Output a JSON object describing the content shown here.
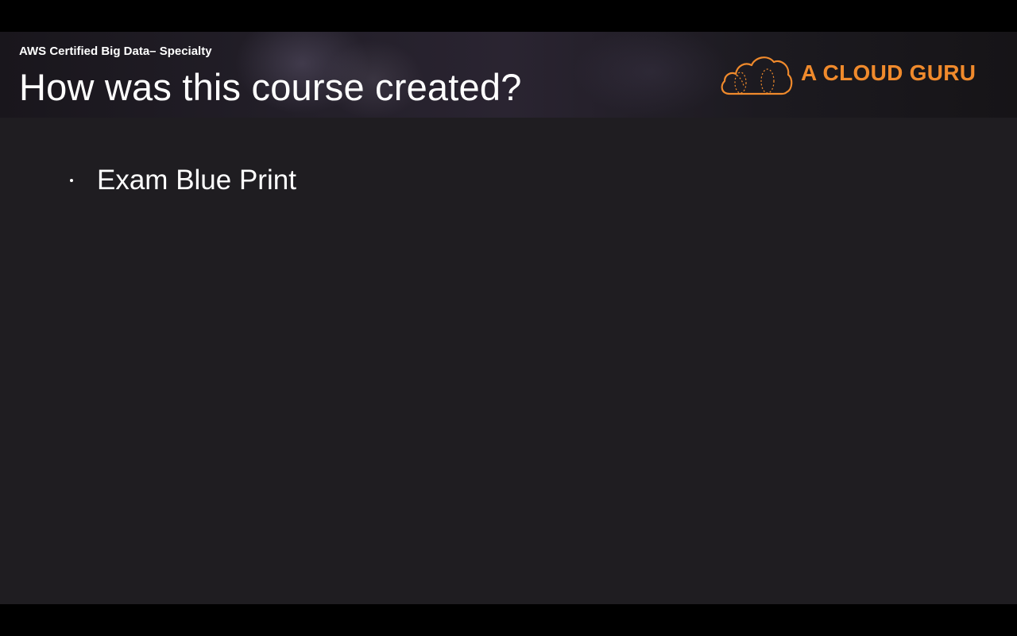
{
  "slide": {
    "course_subtitle": "AWS Certified Big Data– Specialty",
    "title": "How was this course created?",
    "bullets": [
      {
        "text": "Exam Blue Print"
      }
    ]
  },
  "logo": {
    "text": "A CLOUD GURU",
    "icon": "cloud-icon",
    "color": "#f08a2c"
  },
  "colors": {
    "slide_background": "#1f1d21",
    "letterbox": "#000000",
    "text": "#ffffff"
  }
}
